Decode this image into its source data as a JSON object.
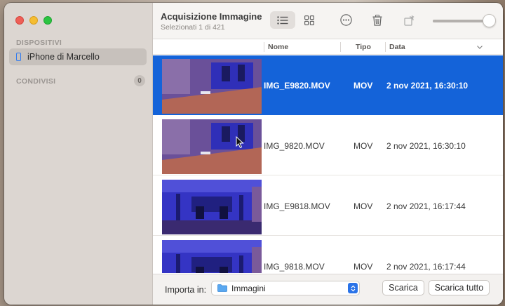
{
  "window": {
    "title": "Acquisizione Immagine",
    "subtitle": "Selezionati 1 di 421"
  },
  "sidebar": {
    "devices_header": "DISPOSITIVI",
    "device_name": "iPhone di Marcello",
    "shared_header": "CONDIVISI",
    "shared_count": "0"
  },
  "toolbar": {
    "icons": [
      "list-view-icon",
      "grid-view-icon",
      "more-options-icon",
      "trash-icon",
      "rotate-icon"
    ],
    "thumbnail_size_slider": 1.0
  },
  "columns": {
    "name": "Nome",
    "type": "Tipo",
    "date": "Data"
  },
  "rows": [
    {
      "name": "IMG_E9820.MOV",
      "type": "MOV",
      "date": "2 nov 2021, 16:30:10",
      "selected": true
    },
    {
      "name": "IMG_9820.MOV",
      "type": "MOV",
      "date": "2 nov 2021, 16:30:10",
      "selected": false
    },
    {
      "name": "IMG_E9818.MOV",
      "type": "MOV",
      "date": "2 nov 2021, 16:17:44",
      "selected": false
    },
    {
      "name": "IMG_9818.MOV",
      "type": "MOV",
      "date": "2 nov 2021, 16:17:44",
      "selected": false
    }
  ],
  "footer": {
    "import_label": "Importa in:",
    "import_destination": "Immagini",
    "download_button": "Scarica",
    "download_all_button": "Scarica tutto"
  },
  "colors": {
    "selection": "#1463d9",
    "accent": "#2a73e8"
  }
}
